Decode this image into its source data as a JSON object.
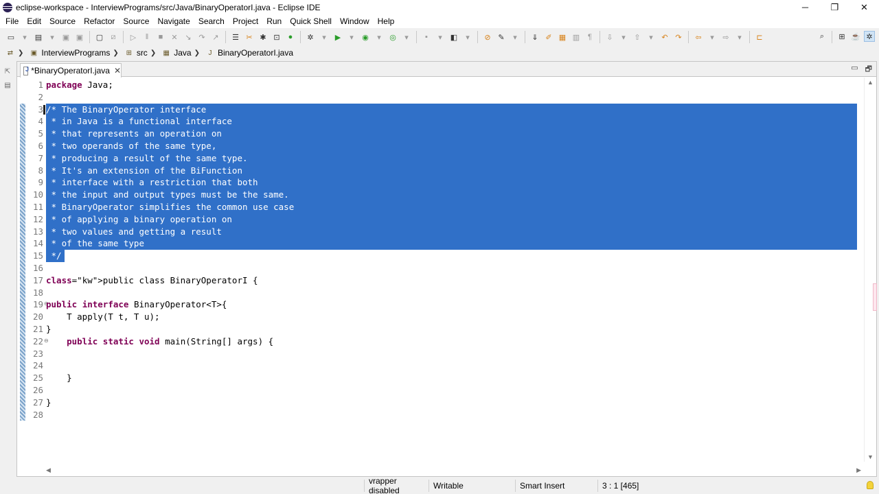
{
  "window": {
    "title": "eclipse-workspace - InterviewPrograms/src/Java/BinaryOperatorI.java - Eclipse IDE",
    "minimize": "─",
    "maximize": "❐",
    "close": "✕"
  },
  "menu": [
    "File",
    "Edit",
    "Source",
    "Refactor",
    "Source",
    "Navigate",
    "Search",
    "Project",
    "Run",
    "Quick Shell",
    "Window",
    "Help"
  ],
  "breadcrumb": [
    {
      "label": "InterviewPrograms",
      "icon": "project-icon"
    },
    {
      "label": "src",
      "icon": "source-folder-icon"
    },
    {
      "label": "Java",
      "icon": "package-icon"
    },
    {
      "label": "BinaryOperatorI.java",
      "icon": "java-file-icon"
    }
  ],
  "editor": {
    "tab_label": "*BinaryOperatorI.java",
    "tab_close": "✕",
    "minimize": "▭",
    "maximize": "🗗",
    "lines": [
      {
        "n": "1",
        "text": "package Java;",
        "selected": false,
        "kw": [
          "package"
        ]
      },
      {
        "n": "2",
        "text": "",
        "selected": false,
        "kw": []
      },
      {
        "n": "3",
        "text": "/* The BinaryOperator interface",
        "selected": true,
        "kw": []
      },
      {
        "n": "4",
        "text": " * in Java is a functional interface",
        "selected": true,
        "kw": []
      },
      {
        "n": "5",
        "text": " * that represents an operation on",
        "selected": true,
        "kw": []
      },
      {
        "n": "6",
        "text": " * two operands of the same type,",
        "selected": true,
        "kw": []
      },
      {
        "n": "7",
        "text": " * producing a result of the same type.",
        "selected": true,
        "kw": []
      },
      {
        "n": "8",
        "text": " * It's an extension of the BiFunction",
        "selected": true,
        "kw": []
      },
      {
        "n": "9",
        "text": " * interface with a restriction that both",
        "selected": true,
        "kw": []
      },
      {
        "n": "10",
        "text": " * the input and output types must be the same.",
        "selected": true,
        "kw": []
      },
      {
        "n": "11",
        "text": " * BinaryOperator simplifies the common use case",
        "selected": true,
        "kw": []
      },
      {
        "n": "12",
        "text": " * of applying a binary operation on",
        "selected": true,
        "kw": []
      },
      {
        "n": "13",
        "text": " * two values and getting a result",
        "selected": true,
        "kw": []
      },
      {
        "n": "14",
        "text": " * of the same type",
        "selected": true,
        "kw": []
      },
      {
        "n": "15",
        "text": " */",
        "selected": "partial",
        "kw": []
      },
      {
        "n": "16",
        "text": "",
        "selected": false,
        "kw": []
      },
      {
        "n": "17",
        "text": "public class BinaryOperatorI {",
        "selected": false,
        "kw": [
          "public",
          "class"
        ]
      },
      {
        "n": "18",
        "text": "",
        "selected": false,
        "kw": []
      },
      {
        "n": "19",
        "text": "public interface BinaryOperator<T>{",
        "selected": false,
        "kw": [
          "public",
          "interface"
        ],
        "fold": true
      },
      {
        "n": "20",
        "text": "    T apply(T t, T u);",
        "selected": false,
        "kw": []
      },
      {
        "n": "21",
        "text": "}",
        "selected": false,
        "kw": []
      },
      {
        "n": "22",
        "text": "    public static void main(String[] args) {",
        "selected": false,
        "kw": [
          "public",
          "static",
          "void"
        ],
        "fold": true
      },
      {
        "n": "23",
        "text": "",
        "selected": false,
        "kw": []
      },
      {
        "n": "24",
        "text": "",
        "selected": false,
        "kw": []
      },
      {
        "n": "25",
        "text": "    }",
        "selected": false,
        "kw": []
      },
      {
        "n": "26",
        "text": "",
        "selected": false,
        "kw": []
      },
      {
        "n": "27",
        "text": "}",
        "selected": false,
        "kw": []
      },
      {
        "n": "28",
        "text": "",
        "selected": false,
        "kw": []
      }
    ]
  },
  "status": {
    "wrap": "vrapper disabled",
    "writable": "Writable",
    "insert_mode": "Smart Insert",
    "position": "3 : 1 [465]"
  },
  "colors": {
    "selection": "#3070c8",
    "keyword": "#7f0055",
    "line_number": "#787878"
  }
}
